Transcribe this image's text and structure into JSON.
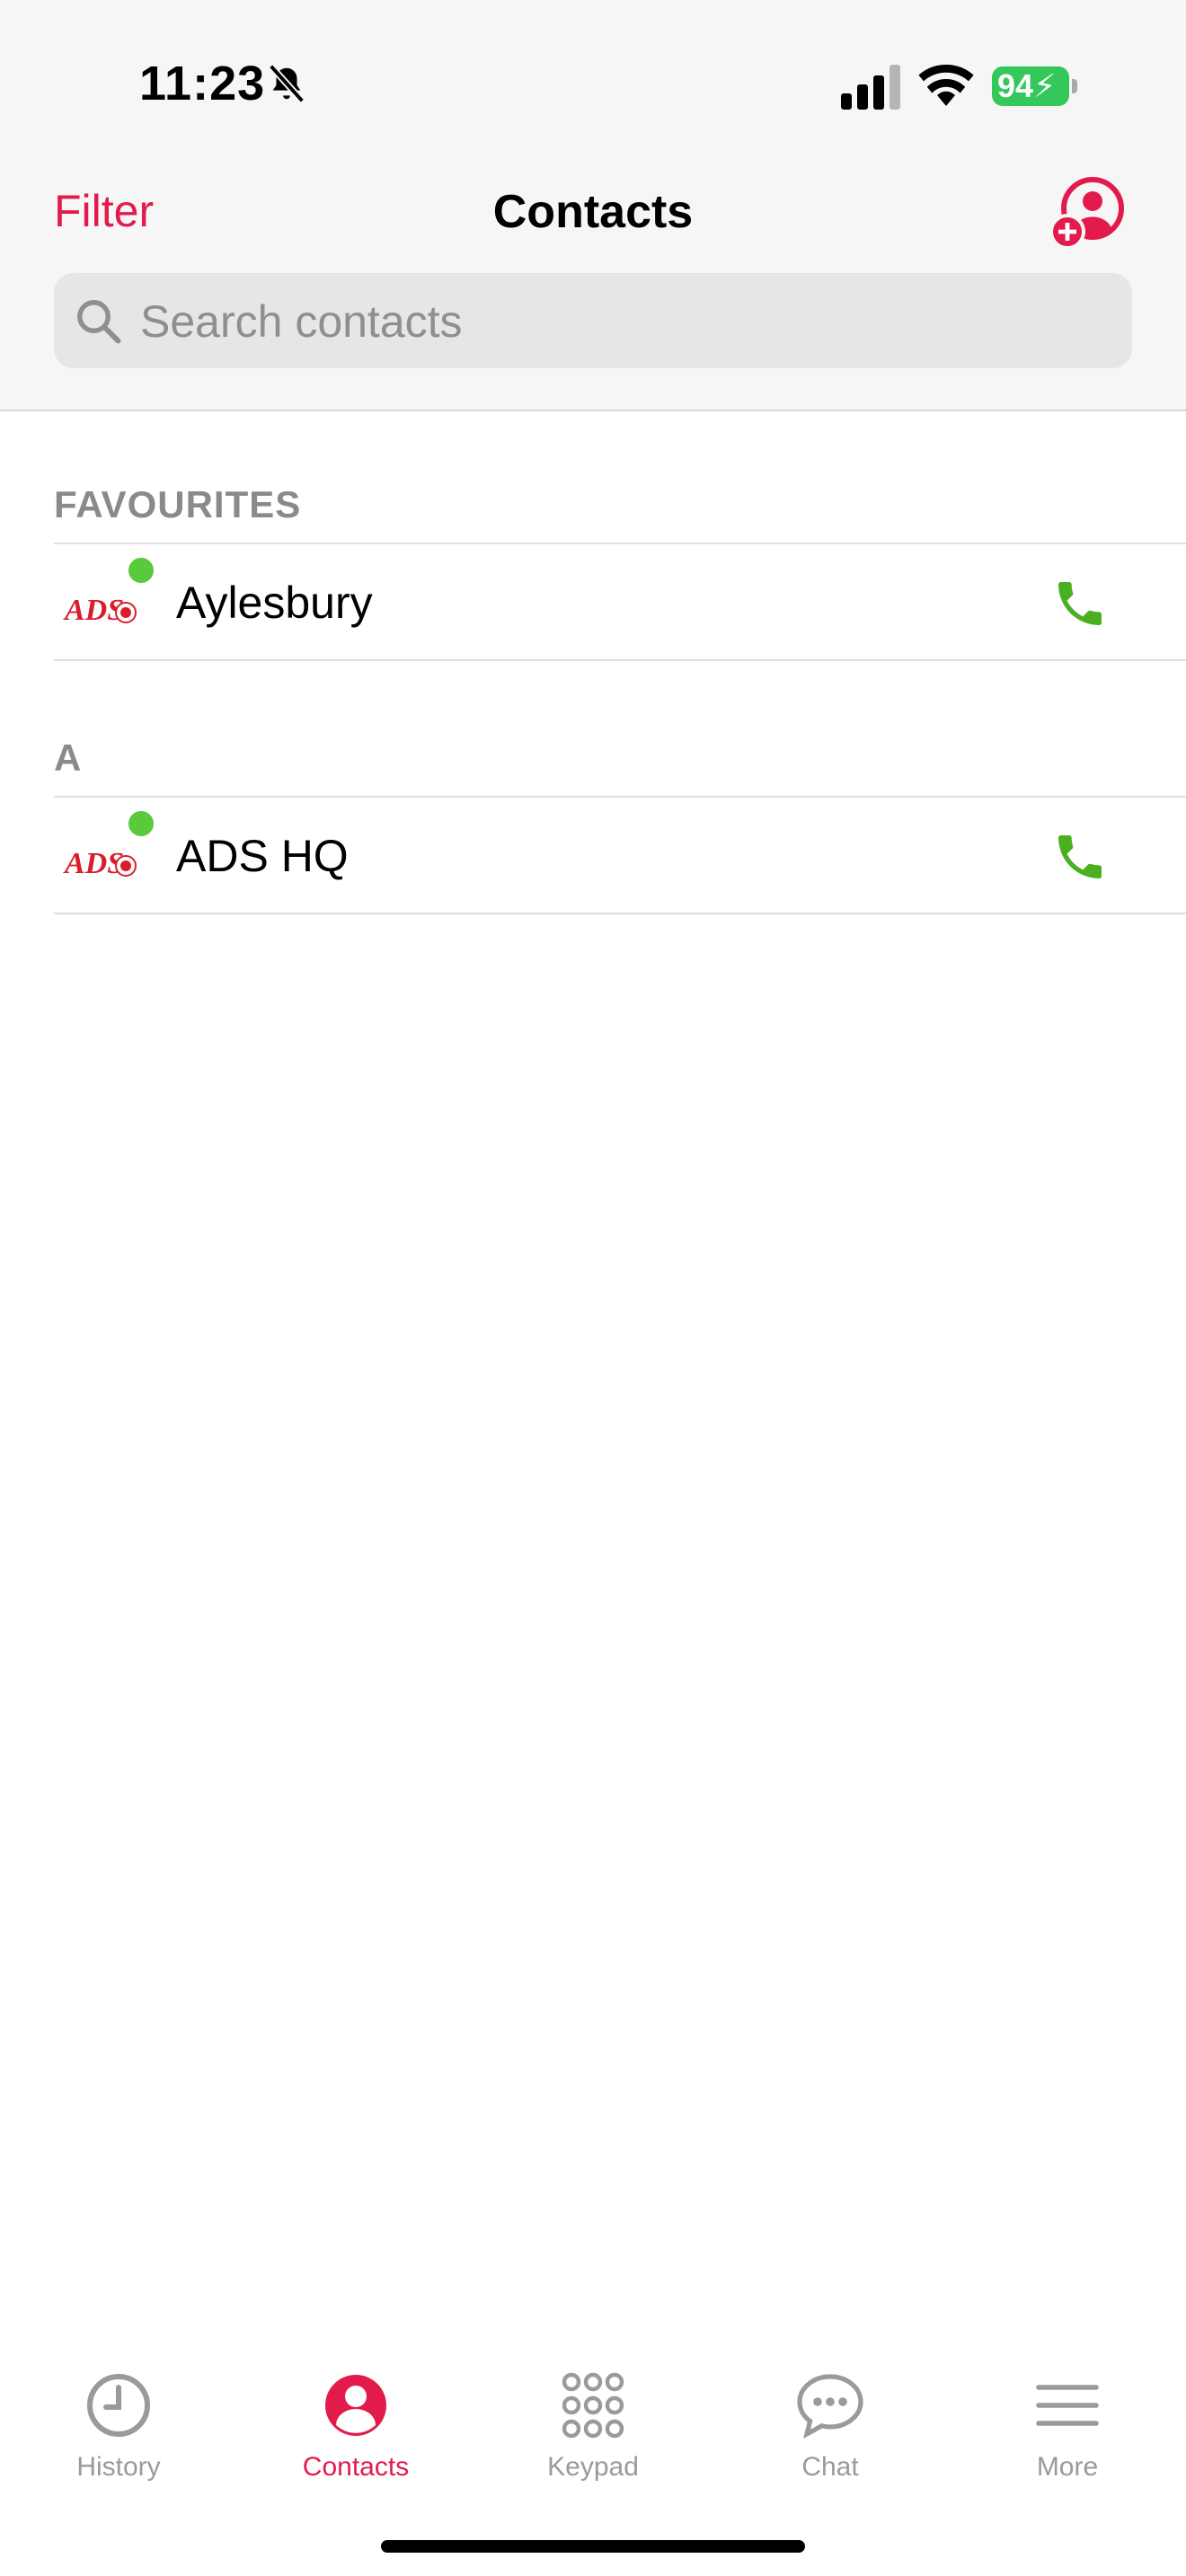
{
  "status_bar": {
    "time": "11:23",
    "battery_level": "94",
    "icons": [
      "bell-slash-icon",
      "cellular-signal-icon",
      "wifi-icon",
      "battery-charging-icon"
    ],
    "battery_color": "#34c759"
  },
  "header": {
    "filter_label": "Filter",
    "title": "Contacts",
    "add_contact_icon": "add-contact-icon",
    "accent_color": "#e31b4d"
  },
  "search": {
    "placeholder": "Search contacts",
    "value": ""
  },
  "sections": [
    {
      "header": "FAVOURITES",
      "contacts": [
        {
          "name": "Aylesbury",
          "avatar_text": "ADS",
          "status": "online",
          "action_icon": "phone-icon"
        }
      ]
    },
    {
      "header": "A",
      "contacts": [
        {
          "name": "ADS HQ",
          "avatar_text": "ADS",
          "status": "online",
          "action_icon": "phone-icon"
        }
      ]
    }
  ],
  "call_color": "#4caf1f",
  "presence_color": "#5ac93c",
  "tabs": [
    {
      "label": "History",
      "icon": "clock-icon",
      "active": false
    },
    {
      "label": "Contacts",
      "icon": "person-circle-icon",
      "active": true
    },
    {
      "label": "Keypad",
      "icon": "keypad-icon",
      "active": false
    },
    {
      "label": "Chat",
      "icon": "chat-bubble-icon",
      "active": false
    },
    {
      "label": "More",
      "icon": "menu-icon",
      "active": false
    }
  ]
}
